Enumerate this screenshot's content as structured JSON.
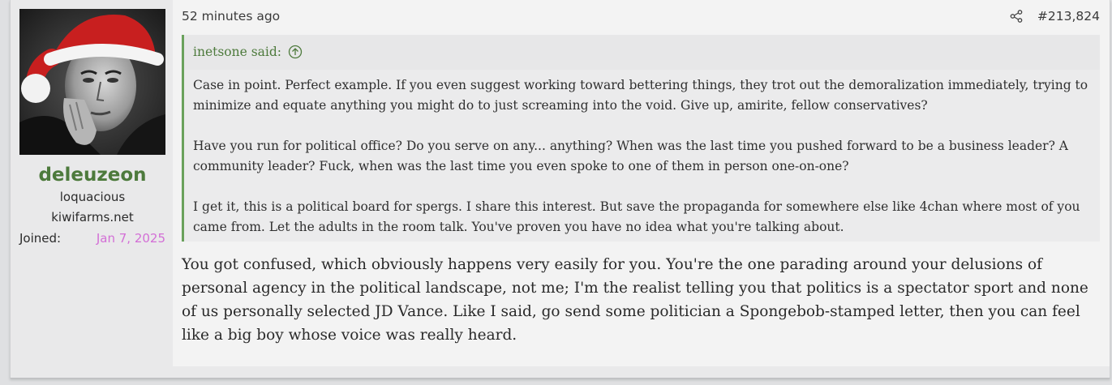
{
  "user": {
    "name": "deleuzeon",
    "title": "loquacious",
    "site": "kiwifarms.net",
    "joined_label": "Joined:",
    "joined_value": "Jan 7, 2025"
  },
  "post": {
    "time": "52 minutes ago",
    "number": "#213,824",
    "share_icon": "share-icon"
  },
  "quote": {
    "author_said": "inetsone said:",
    "jump_icon": "arrow-up-circle-icon",
    "paragraphs": [
      "Case in point. Perfect example. If you even suggest working toward bettering things, they trot out the demoralization immediately, trying to minimize and equate anything you might do to just screaming into the void. Give up, amirite, fellow conservatives?",
      "Have you run for political office? Do you serve on any... anything? When was the last time you pushed forward to be a business leader? A community leader? Fuck, when was the last time you even spoke to one of them in person one-on-one?",
      "I get it, this is a political board for spergs. I share this interest. But save the propaganda for somewhere else like 4chan where most of you came from. Let the adults in the room talk. You've proven you have no idea what you're talking about."
    ]
  },
  "reply": "You got confused, which obviously happens very easily for you. You're the one parading around your delusions of personal agency in the political landscape, not me; I'm the realist telling you that politics is a spectator sport and none of us personally selected JD Vance. Like I said, go send some politician a Spongebob-stamped letter, then you can feel like a big boy whose voice was really heard.",
  "colors": {
    "username": "#4d7a3c",
    "quote_border": "#6aa15c",
    "joined_date": "#d36fd6"
  }
}
